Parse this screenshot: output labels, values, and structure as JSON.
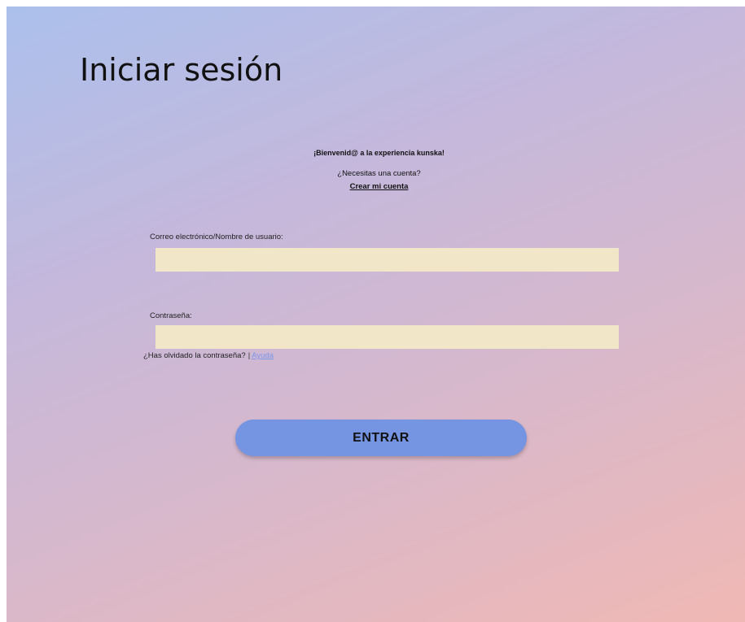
{
  "page": {
    "title": "Iniciar sesión"
  },
  "welcome": {
    "message": "¡Bienvenid@ a la experiencia kunska!",
    "need_account": "¿Necesitas una cuenta?",
    "create_account_link": "Crear mi cuenta"
  },
  "form": {
    "username": {
      "label": "Correo electrónico/Nombre de usuario:",
      "value": "",
      "placeholder": ""
    },
    "password": {
      "label": "Contraseña:",
      "value": "",
      "placeholder": ""
    },
    "forgot_password": {
      "text": "¿Has olvidado la contraseña?",
      "separator": "|",
      "help_link": "Ayuda"
    },
    "submit_label": "ENTRAR"
  },
  "colors": {
    "input_background": "#f2e6c8",
    "button_background": "#7594e2",
    "link_accent": "#7b96e8",
    "gradient_start": "#abc0ec",
    "gradient_end": "#f0b8b4"
  }
}
